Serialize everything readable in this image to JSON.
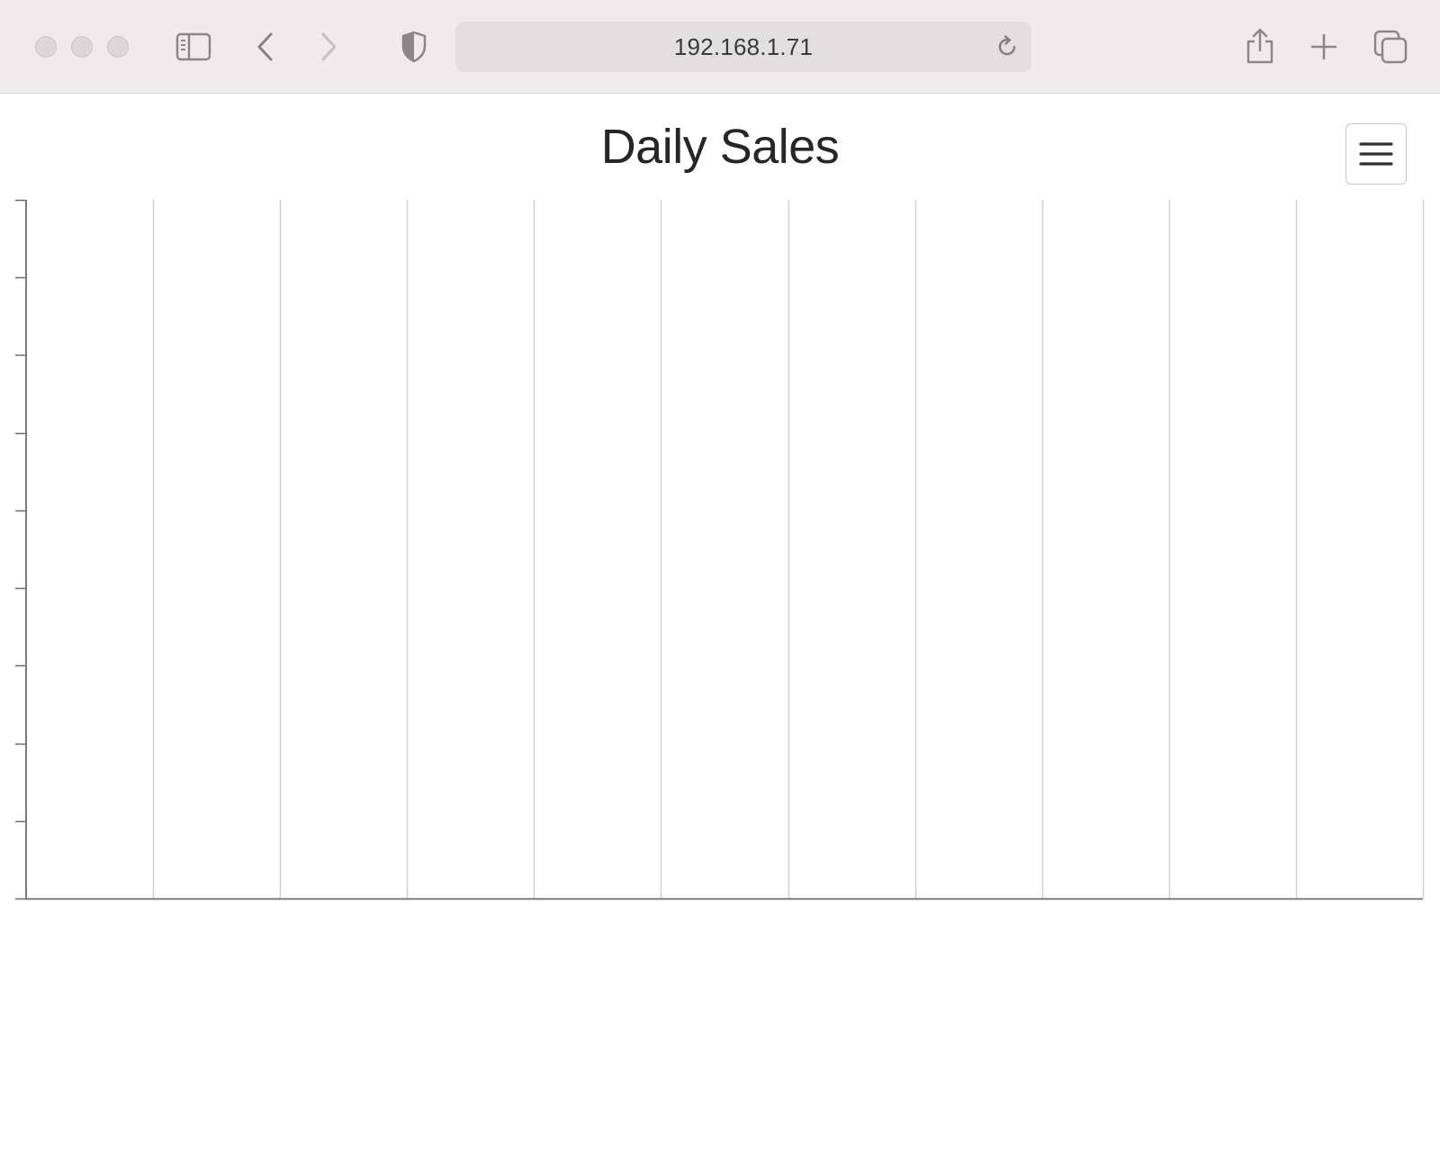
{
  "browser": {
    "url": "192.168.1.71",
    "icons": {
      "sidebar": "sidebar-icon",
      "back": "chevron-left-icon",
      "forward": "chevron-right-icon",
      "privacy": "shield-icon",
      "reload": "reload-icon",
      "share": "share-icon",
      "new_tab": "plus-icon",
      "tabs": "tabs-overview-icon"
    }
  },
  "page": {
    "menu_icon": "hamburger-menu-icon"
  },
  "chart_data": {
    "type": "line",
    "title": "Daily Sales",
    "series": [],
    "x_gridlines": 11,
    "y_ticks": 10,
    "grid": true,
    "colors": {
      "axis": "#6b6b6b",
      "grid": "#cfcfcf"
    }
  }
}
